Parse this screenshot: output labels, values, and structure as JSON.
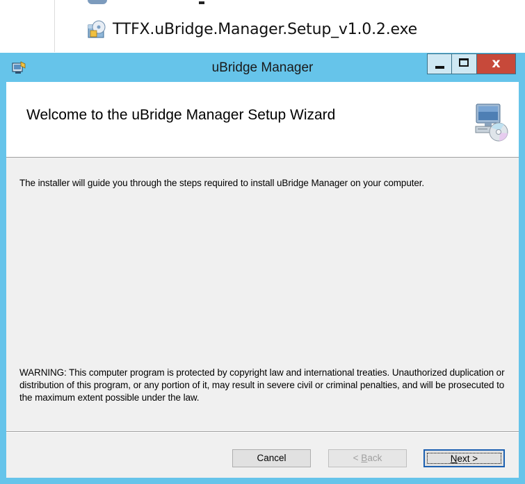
{
  "explorer": {
    "file_name": "TTFX.uBridge.Manager.Setup_v1.0.2.exe",
    "file_icon": "installer-package-icon"
  },
  "window": {
    "title": "uBridge Manager",
    "title_icon": "setup-app-icon",
    "minimize_glyph": "minimize-icon",
    "maximize_glyph": "maximize-icon",
    "close_glyph": "x",
    "accent_color": "#66c4ea",
    "close_color": "#c7493a"
  },
  "banner": {
    "title": "Welcome to the uBridge Manager Setup Wizard",
    "icon": "computer-cd-icon"
  },
  "body": {
    "intro": "The installer will guide you through the steps required to install uBridge Manager on your computer.",
    "warning": "WARNING: This computer program is protected by copyright law and international treaties. Unauthorized duplication or distribution of this program, or any portion of it, may result in severe civil or criminal penalties, and will be prosecuted to the maximum extent possible under the law."
  },
  "buttons": {
    "cancel": "Cancel",
    "back_prefix": "< ",
    "back_mnemonic": "B",
    "back_rest": "ack",
    "next_mnemonic": "N",
    "next_rest": "ext >"
  }
}
